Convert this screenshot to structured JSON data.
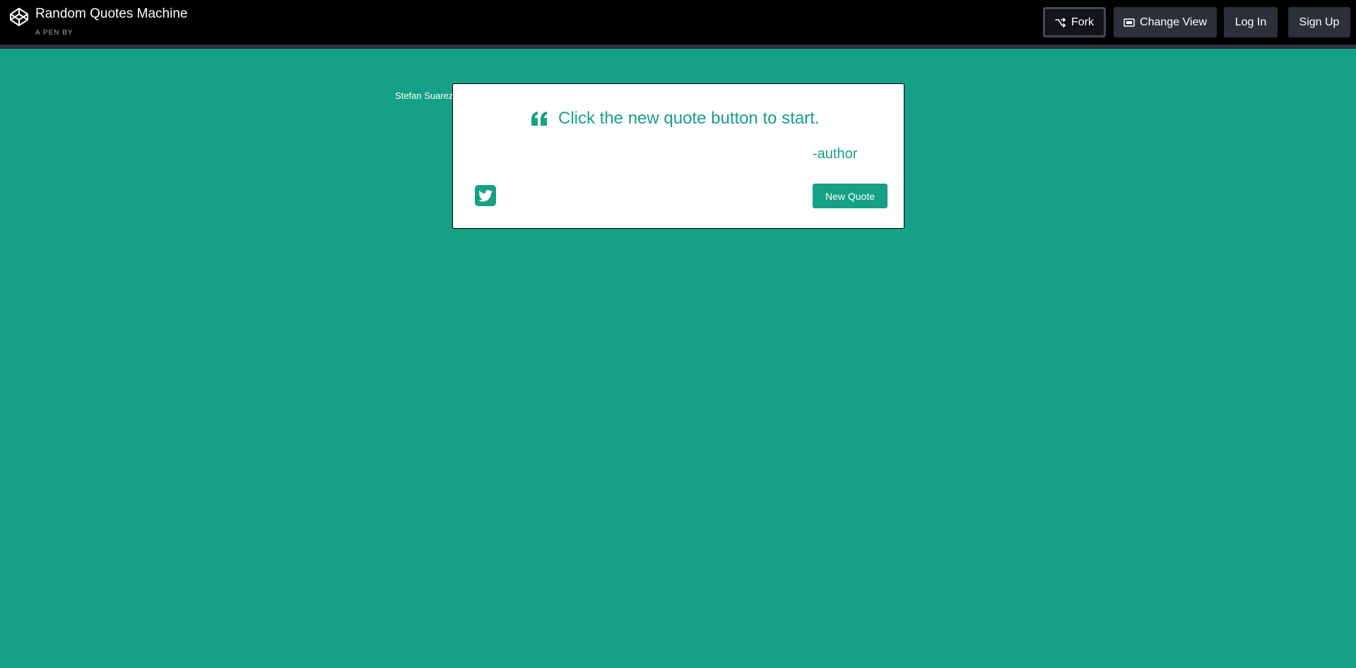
{
  "header": {
    "title": "Random Quotes Machine",
    "by_prefix": "A PEN BY",
    "author": "Stefan Suarez",
    "logo_icon": "codepen-logo-icon",
    "buttons": {
      "fork": "Fork",
      "change_view": "Change View",
      "login": "Log In",
      "signup": "Sign Up"
    }
  },
  "quote_card": {
    "quote_icon": "quote-left-icon",
    "quote_text": "Click the new quote button to start.",
    "author": "-author",
    "tweet_icon": "twitter-icon",
    "new_quote_label": "New Quote"
  },
  "colors": {
    "background": "#16a085",
    "header": "#000000",
    "button": "#2c303a",
    "card": "#ffffff"
  }
}
